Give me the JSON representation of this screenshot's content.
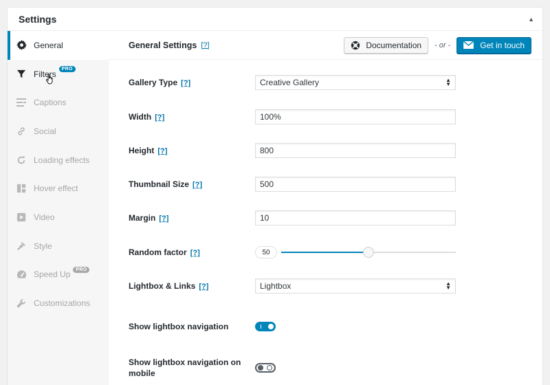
{
  "panel": {
    "title": "Settings"
  },
  "sidebar": {
    "items": [
      {
        "label": "General",
        "icon": "gear-icon"
      },
      {
        "label": "Filters",
        "icon": "funnel-icon",
        "badge": "PRO"
      },
      {
        "label": "Captions",
        "icon": "captions-icon"
      },
      {
        "label": "Social",
        "icon": "link-icon"
      },
      {
        "label": "Loading effects",
        "icon": "refresh-icon"
      },
      {
        "label": "Hover effect",
        "icon": "layout-grid-icon"
      },
      {
        "label": "Video",
        "icon": "play-icon"
      },
      {
        "label": "Style",
        "icon": "paint-brush-icon"
      },
      {
        "label": "Speed Up",
        "icon": "speedometer-icon",
        "badge": "PRO"
      },
      {
        "label": "Customizations",
        "icon": "wrench-icon"
      }
    ]
  },
  "content": {
    "title": "General Settings",
    "help": "[?]",
    "documentation_label": "Documentation",
    "or_label": "- or -",
    "contact_label": "Get in touch"
  },
  "form": {
    "gallery_type": {
      "label": "Gallery Type",
      "value": "Creative Gallery"
    },
    "width": {
      "label": "Width",
      "value": "100%"
    },
    "height": {
      "label": "Height",
      "value": "800"
    },
    "thumbnail_size": {
      "label": "Thumbnail Size",
      "value": "500"
    },
    "margin": {
      "label": "Margin",
      "value": "10"
    },
    "random_factor": {
      "label": "Random factor",
      "value": "50",
      "min": 0,
      "max": 100
    },
    "lightbox_links": {
      "label": "Lightbox & Links",
      "value": "Lightbox"
    },
    "show_lightbox_nav": {
      "label": "Show lightbox navigation",
      "enabled": true
    },
    "show_lightbox_nav_mobile": {
      "label": "Show lightbox navigation on mobile",
      "enabled": false
    }
  },
  "colors": {
    "accent": "#0085ba",
    "link": "#0073aa",
    "text": "#23282d"
  }
}
